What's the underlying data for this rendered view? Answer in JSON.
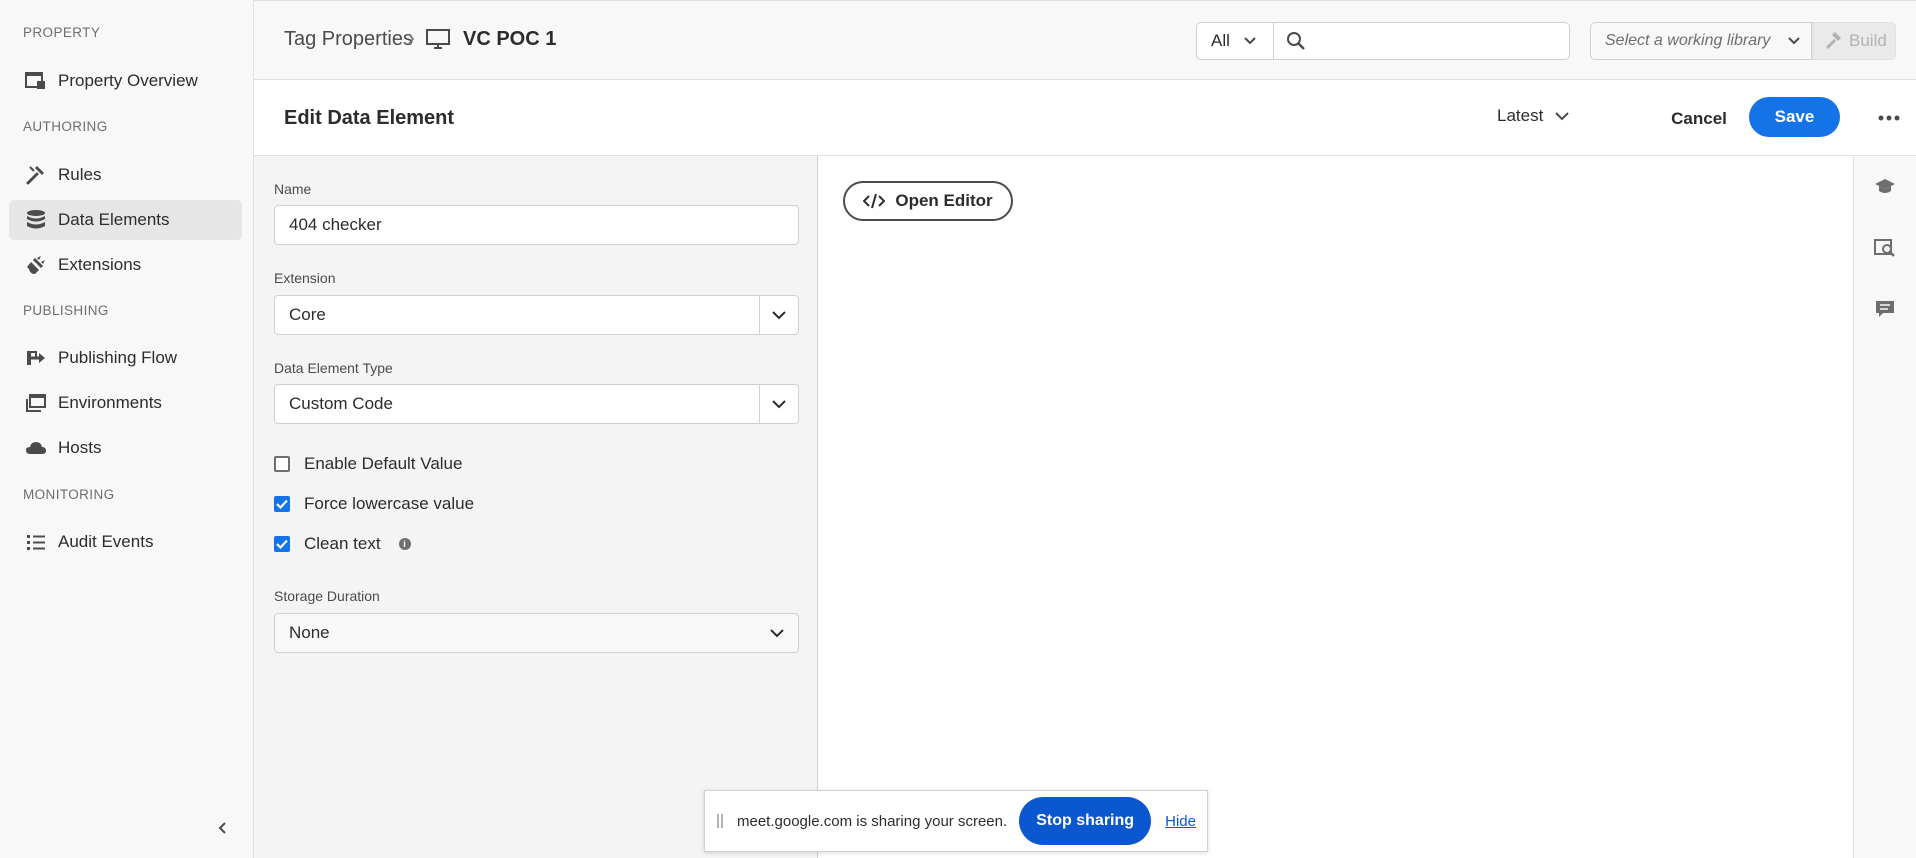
{
  "sidebar": {
    "sections": [
      {
        "heading": "PROPERTY"
      },
      {
        "heading": "AUTHORING"
      },
      {
        "heading": "PUBLISHING"
      },
      {
        "heading": "MONITORING"
      }
    ],
    "items": [
      {
        "label": "Property Overview",
        "icon": "property-overview-icon"
      },
      {
        "label": "Rules",
        "icon": "rules-icon"
      },
      {
        "label": "Data Elements",
        "icon": "data-elements-icon",
        "active": true
      },
      {
        "label": "Extensions",
        "icon": "extensions-icon"
      },
      {
        "label": "Publishing Flow",
        "icon": "publishing-flow-icon"
      },
      {
        "label": "Environments",
        "icon": "environments-icon"
      },
      {
        "label": "Hosts",
        "icon": "hosts-cloud-icon"
      },
      {
        "label": "Audit Events",
        "icon": "audit-events-icon"
      }
    ]
  },
  "topbar": {
    "breadcrumb_parent": "Tag Properties",
    "breadcrumb_current": "VC POC 1",
    "scope_value": "All",
    "search_placeholder": "",
    "library_placeholder": "Select a working library",
    "build_label": "Build"
  },
  "header": {
    "title": "Edit Data Element",
    "revision": "Latest",
    "cancel_label": "Cancel",
    "save_label": "Save"
  },
  "form": {
    "name_label": "Name",
    "name_value": "404 checker",
    "extension_label": "Extension",
    "extension_value": "Core",
    "type_label": "Data Element Type",
    "type_value": "Custom Code",
    "checkboxes": [
      {
        "label": "Enable Default Value",
        "checked": false
      },
      {
        "label": "Force lowercase value",
        "checked": true
      },
      {
        "label": "Clean text",
        "checked": true
      }
    ],
    "storage_label": "Storage Duration",
    "storage_value": "None"
  },
  "editor": {
    "open_editor_label": "Open Editor"
  },
  "share_bar": {
    "message": "meet.google.com is sharing your screen.",
    "stop_label": "Stop sharing",
    "hide_label": "Hide"
  },
  "colors": {
    "accent": "#1473e6",
    "share_button": "#0b57d0"
  }
}
